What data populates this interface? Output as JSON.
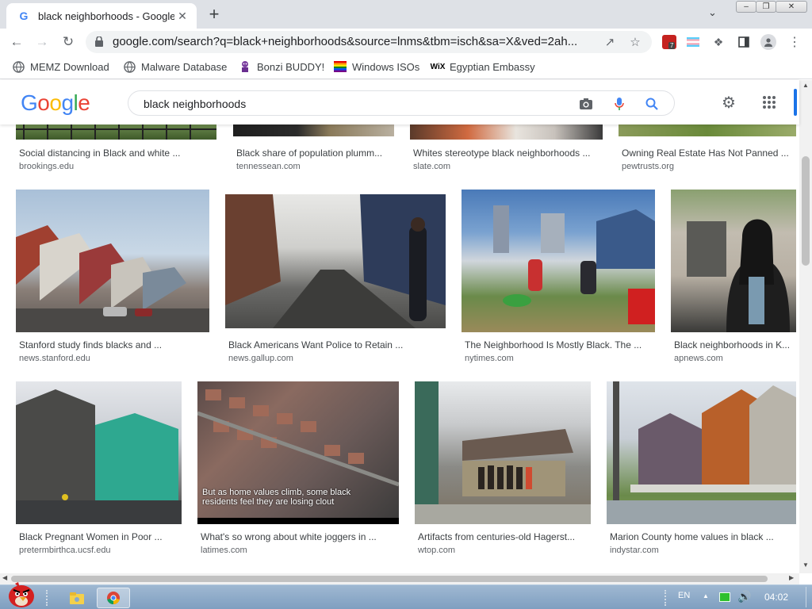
{
  "browser": {
    "tab": {
      "title": "black neighborhoods - Google",
      "close": "✕"
    },
    "new_tab": "+",
    "url": "google.com/search?q=black+neighborhoods&source=lnms&tbm=isch&sa=X&ved=2ah...",
    "extension_badge": "7"
  },
  "bookmarks": [
    {
      "label": "MEMZ Download",
      "icon": "globe-icon"
    },
    {
      "label": "Malware Database",
      "icon": "globe-icon"
    },
    {
      "label": "Bonzi BUDDY!",
      "icon": "bonzi-icon"
    },
    {
      "label": "Windows ISOs",
      "icon": "windows-flag-icon"
    },
    {
      "label": "Egyptian Embassy",
      "icon": "wix-icon"
    }
  ],
  "google": {
    "logo_letters": [
      "G",
      "o",
      "o",
      "g",
      "l",
      "e"
    ],
    "logo_colors": [
      "#4285f4",
      "#ea4335",
      "#fbbc05",
      "#4285f4",
      "#34a853",
      "#ea4335"
    ],
    "query": "black neighborhoods"
  },
  "results": {
    "row0": [
      {
        "title": "Social distancing in Black and white ...",
        "source": "brookings.edu"
      },
      {
        "title": "Black share of population plumm...",
        "source": "tennessean.com"
      },
      {
        "title": "Whites stereotype black neighborhoods ...",
        "source": "slate.com"
      },
      {
        "title": "Owning Real Estate Has Not Panned ...",
        "source": "pewtrusts.org"
      }
    ],
    "row1": [
      {
        "title": "Stanford study finds blacks and ...",
        "source": "news.stanford.edu"
      },
      {
        "title": "Black Americans Want Police to Retain ...",
        "source": "news.gallup.com"
      },
      {
        "title": "The Neighborhood Is Mostly Black. The ...",
        "source": "nytimes.com"
      },
      {
        "title": "Black neighborhoods in K...",
        "source": "apnews.com"
      }
    ],
    "row2": [
      {
        "title": "Black Pregnant Women in Poor ...",
        "source": "pretermbirthca.ucsf.edu"
      },
      {
        "title": "What's so wrong about white joggers in ...",
        "source": "latimes.com"
      },
      {
        "title": "Artifacts from centuries-old Hagerst...",
        "source": "wtop.com"
      },
      {
        "title": "Marion County home values in black ...",
        "source": "indystar.com"
      }
    ],
    "overlay_text": "But as home values climb, some black residents feel they are losing clout"
  },
  "taskbar": {
    "language": "EN",
    "time": "04:02"
  }
}
